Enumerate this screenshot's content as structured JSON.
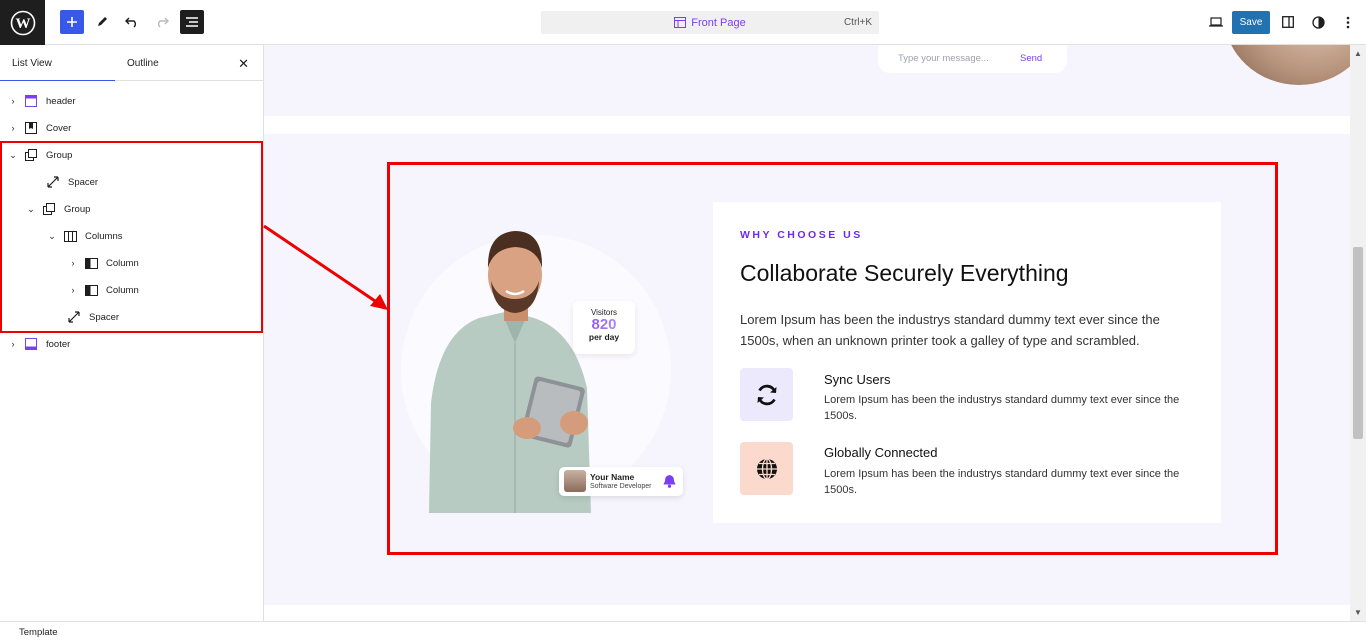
{
  "topbar": {
    "document_title": "Front Page",
    "shortcut": "Ctrl+K",
    "save_label": "Save"
  },
  "sidebar": {
    "tabs": [
      {
        "label": "List View"
      },
      {
        "label": "Outline"
      }
    ],
    "tree": [
      {
        "label": "header",
        "icon": "template-part-icon",
        "expanded": false
      },
      {
        "label": "Cover",
        "icon": "cover-icon",
        "expanded": false
      },
      {
        "label": "Group",
        "icon": "group-icon",
        "expanded": true
      },
      {
        "label": "Spacer",
        "icon": "spacer-icon"
      },
      {
        "label": "Group",
        "icon": "group-icon",
        "expanded": true
      },
      {
        "label": "Columns",
        "icon": "columns-icon",
        "expanded": true
      },
      {
        "label": "Column",
        "icon": "column-icon",
        "expanded": false
      },
      {
        "label": "Column",
        "icon": "column-icon",
        "expanded": false
      },
      {
        "label": "Spacer",
        "icon": "spacer-icon"
      },
      {
        "label": "footer",
        "icon": "template-part-icon",
        "expanded": false
      }
    ]
  },
  "canvas": {
    "message": {
      "placeholder": "Type your message...",
      "send": "Send"
    },
    "visitors": {
      "label": "Visitors",
      "count": "820",
      "sub": "per day"
    },
    "profile": {
      "name": "Your Name",
      "role": "Software Developer"
    },
    "eyebrow": "WHY CHOOSE US",
    "heading": "Collaborate Securely Everything",
    "paragraph": "Lorem Ipsum has been the industrys standard dummy text ever since the 1500s, when an unknown printer took a galley of type and scrambled.",
    "features": [
      {
        "title": "Sync Users",
        "text": "Lorem Ipsum has been the industrys standard dummy text ever since the 1500s."
      },
      {
        "title": "Globally Connected",
        "text": "Lorem Ipsum has been the industrys standard dummy text ever since the 1500s."
      }
    ]
  },
  "footer": {
    "breadcrumb": "Template"
  },
  "colors": {
    "accent": "#7a3ff0",
    "highlight": "#ee0000",
    "save": "#2271b1"
  }
}
